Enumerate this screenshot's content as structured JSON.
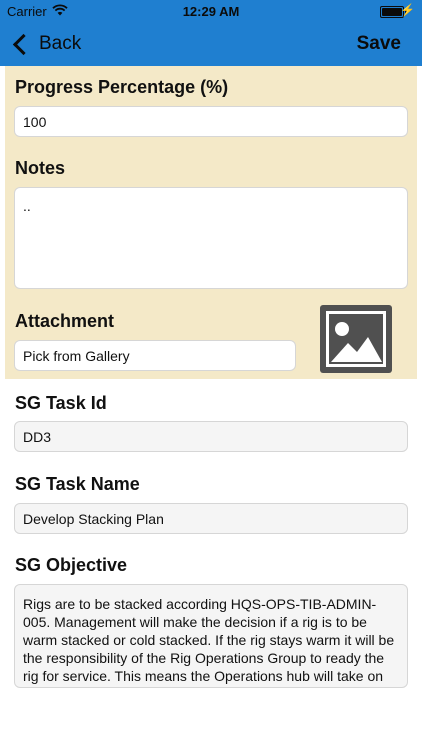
{
  "status_bar": {
    "carrier": "Carrier",
    "time": "12:29 AM"
  },
  "nav": {
    "back_label": "Back",
    "save_label": "Save"
  },
  "form": {
    "progress": {
      "label": "Progress Percentage (%)",
      "value": "100"
    },
    "notes": {
      "label": "Notes",
      "value": ".."
    },
    "attachment": {
      "label": "Attachment",
      "button_label": "Pick from Gallery",
      "thumbnail_icon": "image-placeholder-icon"
    },
    "task_id": {
      "label": "SG Task Id",
      "value": "DD3"
    },
    "task_name": {
      "label": "SG Task Name",
      "value": "Develop Stacking Plan"
    },
    "objective": {
      "label": "SG Objective",
      "value": "Rigs are to be stacked according HQS-OPS-TIB-ADMIN-005.  Management will make the decision if a rig is to be warm stacked or cold stacked.  If the rig stays warm it will be the responsibility of the Rig Operations Group to ready the rig for service.  This means the Operations hub will take on all the tasks required to plan"
    }
  },
  "colors": {
    "nav_bar": "#1f7fd0",
    "section_background": "#f4e9c8"
  }
}
